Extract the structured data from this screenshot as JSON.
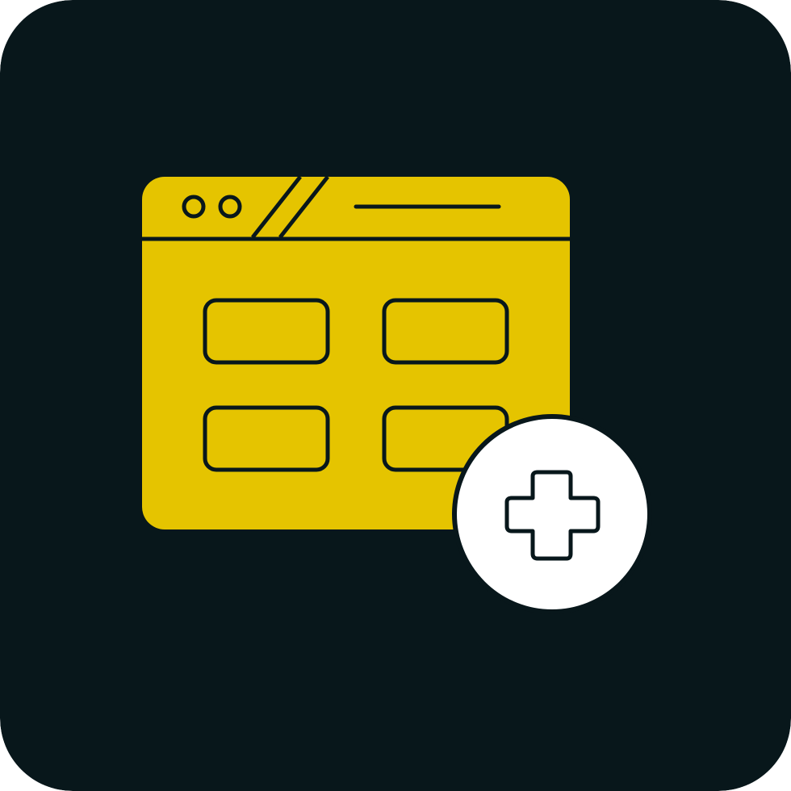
{
  "icon": {
    "name": "web-page-add-icon",
    "parts": [
      "browser-window-icon",
      "grid-blocks-icon",
      "add-plus-icon"
    ]
  },
  "colors": {
    "background": "#08171b",
    "window_fill": "#e5c400",
    "outline": "#08171b",
    "badge_fill": "#ffffff"
  }
}
